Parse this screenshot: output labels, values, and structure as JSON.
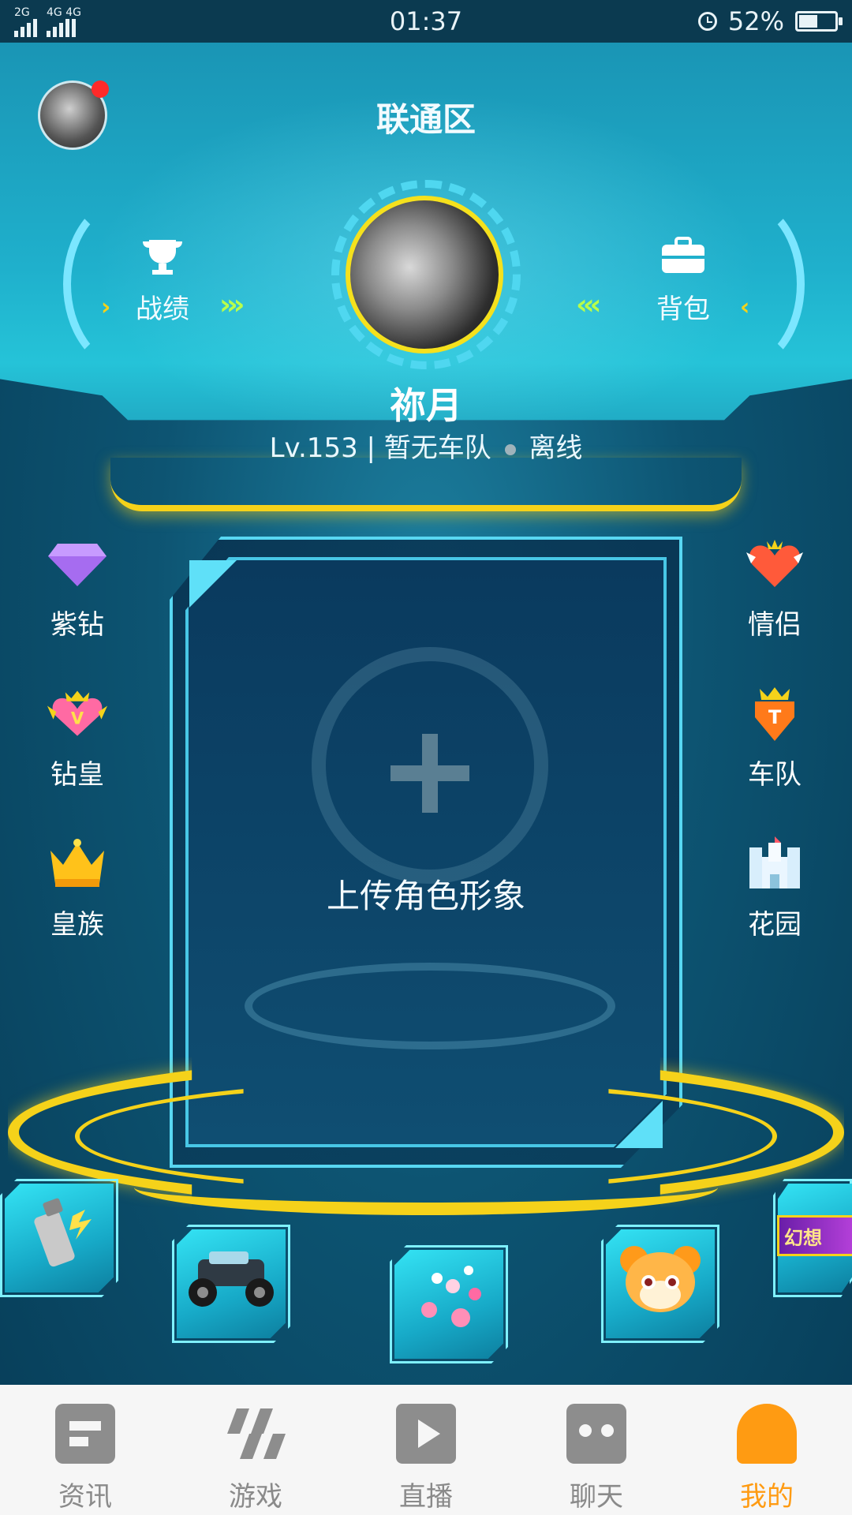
{
  "status_bar": {
    "signal_left": "2G",
    "signal_right": "4G 4G",
    "time": "01:37",
    "battery": "52%",
    "battery_level": 0.52
  },
  "header": {
    "server_title": "联通区",
    "left_button": "战绩",
    "right_button": "背包",
    "nickname": "祢月",
    "level": "Lv.153",
    "team": "暂无车队",
    "online_status": "离线"
  },
  "left_menu": [
    {
      "label": "紫钻",
      "icon": "purple-diamond-icon"
    },
    {
      "label": "钻皇",
      "icon": "diamond-king-icon"
    },
    {
      "label": "皇族",
      "icon": "royal-crown-icon"
    }
  ],
  "right_menu": [
    {
      "label": "情侣",
      "icon": "couple-heart-icon"
    },
    {
      "label": "车队",
      "icon": "team-shield-icon"
    },
    {
      "label": "花园",
      "icon": "garden-castle-icon"
    }
  ],
  "card": {
    "upload_text": "上传角色形象"
  },
  "slots": {
    "fantasy_label": "幻想"
  },
  "bottom_nav": [
    {
      "label": "资讯",
      "icon": "news-icon"
    },
    {
      "label": "游戏",
      "icon": "game-icon"
    },
    {
      "label": "直播",
      "icon": "live-play-icon"
    },
    {
      "label": "聊天",
      "icon": "chat-icon"
    },
    {
      "label": "我的",
      "icon": "profile-cap-icon",
      "active": true
    }
  ],
  "colors": {
    "accent": "#f5d21a",
    "cyan": "#4fd7f0",
    "active_tab": "#ff9b12"
  }
}
